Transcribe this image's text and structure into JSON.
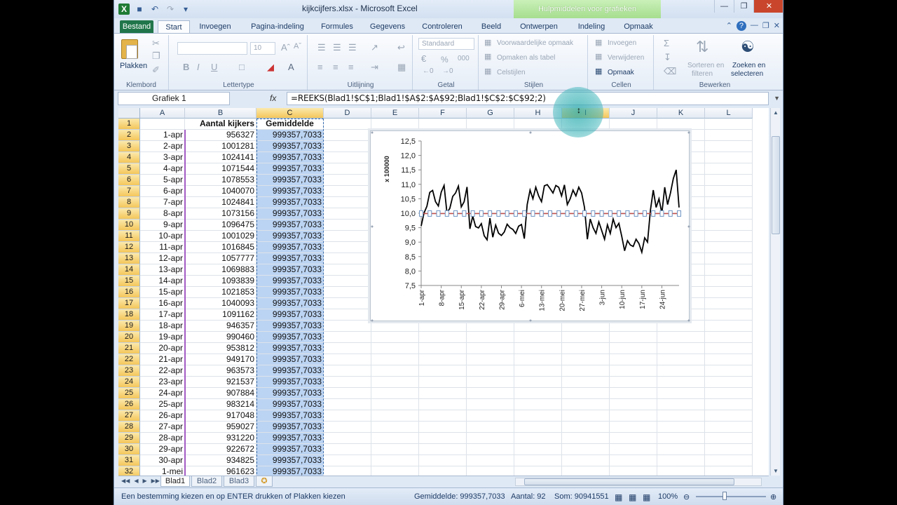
{
  "window": {
    "title": "kijkcijfers.xlsx - Microsoft Excel",
    "tools_tab": "Hulpmiddelen voor grafieken"
  },
  "tabs": {
    "file": "Bestand",
    "items": [
      "Start",
      "Invoegen",
      "Pagina-indeling",
      "Formules",
      "Gegevens",
      "Controleren",
      "Beeld",
      "Ontwerpen",
      "Indeling",
      "Opmaak"
    ]
  },
  "ribbon": {
    "groups": {
      "clipboard": "Klembord",
      "font": "Lettertype",
      "alignment": "Uitlijning",
      "number": "Getal",
      "styles": "Stijlen",
      "cells": "Cellen",
      "editing": "Bewerken"
    },
    "paste_label": "Plakken",
    "font_size": "10",
    "number_format": "Standaard",
    "conditional_format": "Voorwaardelijke opmaak",
    "format_as_table": "Opmaken als tabel",
    "cell_styles": "Celstijlen",
    "insert": "Invoegen",
    "delete": "Verwijderen",
    "format": "Opmaak",
    "sort_filter_1": "Sorteren en",
    "sort_filter_2": "filteren",
    "find_select_1": "Zoeken en",
    "find_select_2": "selecteren",
    "bold": "B",
    "italic": "I",
    "underline": "U",
    "percent": "%",
    "thousands": "000"
  },
  "formula_bar": {
    "name_box": "Grafiek 1",
    "fx": "fx",
    "formula": "=REEKS(Blad1!$C$1;Blad1!$A$2:$A$92;Blad1!$C$2:$C$92;2)"
  },
  "columns": [
    "A",
    "B",
    "C",
    "D",
    "E",
    "F",
    "G",
    "H",
    "I",
    "J",
    "K",
    "L"
  ],
  "rows": [
    {
      "n": "1",
      "a": "",
      "b": "Aantal kijkers",
      "c": "Gemiddelde"
    },
    {
      "n": "2",
      "a": "1-apr",
      "b": "956327",
      "c": "999357,7033"
    },
    {
      "n": "3",
      "a": "2-apr",
      "b": "1001281",
      "c": "999357,7033"
    },
    {
      "n": "4",
      "a": "3-apr",
      "b": "1024141",
      "c": "999357,7033"
    },
    {
      "n": "5",
      "a": "4-apr",
      "b": "1071544",
      "c": "999357,7033"
    },
    {
      "n": "6",
      "a": "5-apr",
      "b": "1078553",
      "c": "999357,7033"
    },
    {
      "n": "7",
      "a": "6-apr",
      "b": "1040070",
      "c": "999357,7033"
    },
    {
      "n": "8",
      "a": "7-apr",
      "b": "1024841",
      "c": "999357,7033"
    },
    {
      "n": "9",
      "a": "8-apr",
      "b": "1073156",
      "c": "999357,7033"
    },
    {
      "n": "10",
      "a": "9-apr",
      "b": "1096475",
      "c": "999357,7033"
    },
    {
      "n": "11",
      "a": "10-apr",
      "b": "1001029",
      "c": "999357,7033"
    },
    {
      "n": "12",
      "a": "11-apr",
      "b": "1016845",
      "c": "999357,7033"
    },
    {
      "n": "13",
      "a": "12-apr",
      "b": "1057777",
      "c": "999357,7033"
    },
    {
      "n": "14",
      "a": "13-apr",
      "b": "1069883",
      "c": "999357,7033"
    },
    {
      "n": "15",
      "a": "14-apr",
      "b": "1093839",
      "c": "999357,7033"
    },
    {
      "n": "16",
      "a": "15-apr",
      "b": "1021853",
      "c": "999357,7033"
    },
    {
      "n": "17",
      "a": "16-apr",
      "b": "1040093",
      "c": "999357,7033"
    },
    {
      "n": "18",
      "a": "17-apr",
      "b": "1091162",
      "c": "999357,7033"
    },
    {
      "n": "19",
      "a": "18-apr",
      "b": "946357",
      "c": "999357,7033"
    },
    {
      "n": "20",
      "a": "19-apr",
      "b": "990460",
      "c": "999357,7033"
    },
    {
      "n": "21",
      "a": "20-apr",
      "b": "953812",
      "c": "999357,7033"
    },
    {
      "n": "22",
      "a": "21-apr",
      "b": "949170",
      "c": "999357,7033"
    },
    {
      "n": "23",
      "a": "22-apr",
      "b": "963573",
      "c": "999357,7033"
    },
    {
      "n": "24",
      "a": "23-apr",
      "b": "921537",
      "c": "999357,7033"
    },
    {
      "n": "25",
      "a": "24-apr",
      "b": "907884",
      "c": "999357,7033"
    },
    {
      "n": "26",
      "a": "25-apr",
      "b": "983214",
      "c": "999357,7033"
    },
    {
      "n": "27",
      "a": "26-apr",
      "b": "917048",
      "c": "999357,7033"
    },
    {
      "n": "28",
      "a": "27-apr",
      "b": "959027",
      "c": "999357,7033"
    },
    {
      "n": "29",
      "a": "28-apr",
      "b": "931220",
      "c": "999357,7033"
    },
    {
      "n": "30",
      "a": "29-apr",
      "b": "922672",
      "c": "999357,7033"
    },
    {
      "n": "31",
      "a": "30-apr",
      "b": "934825",
      "c": "999357,7033"
    },
    {
      "n": "32",
      "a": "1-mei",
      "b": "961623",
      "c": "999357,7033"
    }
  ],
  "chart_data": {
    "type": "line",
    "ylabel": "x 100000",
    "ylim": [
      7.5,
      12.5
    ],
    "yticks": [
      "12,5",
      "12,0",
      "11,5",
      "11,0",
      "10,5",
      "10,0",
      "9,5",
      "9,0",
      "8,5",
      "8,0",
      "7,5"
    ],
    "xticks": [
      "1-apr",
      "8-apr",
      "15-apr",
      "22-apr",
      "29-apr",
      "6-mei",
      "13-mei",
      "20-mei",
      "27-mei",
      "3-jun",
      "10-jun",
      "17-jun",
      "24-jun"
    ],
    "series": [
      {
        "values": [
          9.56,
          10.01,
          10.24,
          10.72,
          10.79,
          10.4,
          10.25,
          10.73,
          10.96,
          10.01,
          10.17,
          10.58,
          10.7,
          10.94,
          10.22,
          10.4,
          10.91,
          9.46,
          9.9,
          9.54,
          9.49,
          9.64,
          9.22,
          9.08,
          9.83,
          9.17,
          9.59,
          9.31,
          9.23,
          9.35,
          9.62,
          9.5,
          9.44,
          9.3,
          9.55,
          9.61,
          9.12,
          10.3,
          10.8,
          10.5,
          10.9,
          10.6,
          10.4,
          10.95,
          10.99,
          10.85,
          10.7,
          10.96,
          10.9,
          10.6,
          10.98,
          10.3,
          10.5,
          10.8,
          10.6,
          10.9,
          10.7,
          10.2,
          9.1,
          9.8,
          9.5,
          9.3,
          9.7,
          9.4,
          9.1,
          9.6,
          9.3,
          9.8,
          9.5,
          9.65,
          9.2,
          8.7,
          9.05,
          8.9,
          8.85,
          9.1,
          8.95,
          8.65,
          9.15,
          9.0,
          10.1,
          10.8,
          10.2,
          10.5,
          10.0,
          10.9,
          10.3,
          10.7,
          11.2,
          11.5,
          10.2
        ],
        "color": "#000000"
      },
      {
        "values": [
          9.99,
          9.99,
          9.99,
          9.99,
          9.99,
          9.99,
          9.99,
          9.99,
          9.99,
          9.99,
          9.99,
          9.99,
          9.99,
          9.99,
          9.99,
          9.99,
          9.99,
          9.99,
          9.99,
          9.99,
          9.99,
          9.99,
          9.99,
          9.99,
          9.99,
          9.99,
          9.99,
          9.99,
          9.99,
          9.99,
          9.99,
          9.99,
          9.99,
          9.99,
          9.99,
          9.99,
          9.99,
          9.99,
          9.99,
          9.99,
          9.99,
          9.99,
          9.99,
          9.99,
          9.99,
          9.99,
          9.99,
          9.99,
          9.99,
          9.99,
          9.99,
          9.99,
          9.99,
          9.99,
          9.99,
          9.99,
          9.99,
          9.99,
          9.99,
          9.99,
          9.99,
          9.99,
          9.99,
          9.99,
          9.99,
          9.99,
          9.99,
          9.99,
          9.99,
          9.99,
          9.99,
          9.99,
          9.99,
          9.99,
          9.99,
          9.99,
          9.99,
          9.99,
          9.99,
          9.99,
          9.99,
          9.99,
          9.99,
          9.99,
          9.99,
          9.99,
          9.99,
          9.99,
          9.99,
          9.99,
          9.99
        ],
        "color": "#c0504d"
      }
    ]
  },
  "sheets": [
    "Blad1",
    "Blad2",
    "Blad3"
  ],
  "status": {
    "message": "Een bestemming kiezen en op ENTER drukken of Plakken kiezen",
    "average": "Gemiddelde: 999357,7033",
    "count": "Aantal: 92",
    "sum": "Som: 90941551",
    "zoom": "100%"
  }
}
